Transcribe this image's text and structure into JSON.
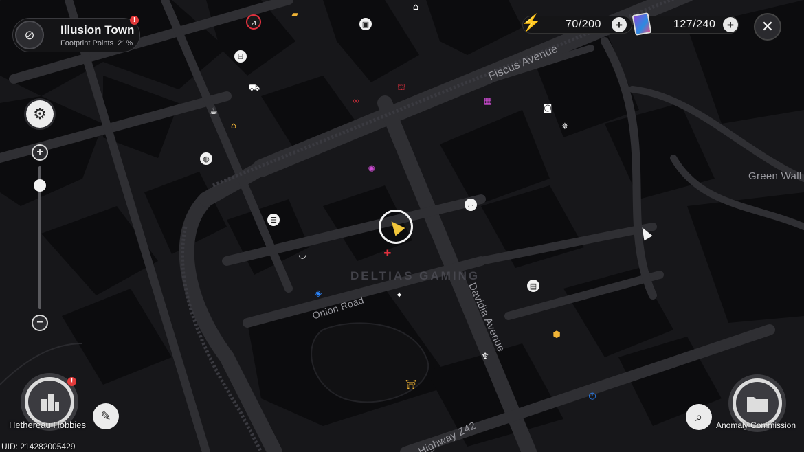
{
  "location": {
    "name": "Illusion Town",
    "footprint_label": "Footprint Points",
    "footprint_value": "21%",
    "alert": "!"
  },
  "resources": [
    {
      "id": "battery",
      "icon": "battery-icon",
      "value": "70/200"
    },
    {
      "id": "cards",
      "icon": "card-icon",
      "value": "127/240"
    }
  ],
  "streets": {
    "fiscus": "Fiscus Avenue",
    "green_wall": "Green Wall",
    "onion": "Onion Road",
    "davidia": "Davidia Avenue",
    "highway": "Highway Z42"
  },
  "bottom": {
    "hobbies_label": "Hethereau Hobbies",
    "hobbies_alert": "!",
    "anomaly_label": "Anomaly Commission",
    "uid": "UID: 214282005429"
  },
  "watermark": "DELTIAS  GAMING",
  "controls": {
    "zoom_in": "+",
    "zoom_out": "−",
    "close": "✕",
    "settings": "⚙",
    "plus": "+"
  },
  "colors": {
    "map_bg": "#17171a",
    "road": "#2f2f33",
    "building": "#0e0e10",
    "accent_gold": "#f1b436",
    "accent_red": "#e2313e"
  },
  "map_icons": [
    {
      "name": "warp-beacon-icon",
      "glyph": "⩘",
      "cls": "redring"
    },
    {
      "name": "gold-stack-icon",
      "glyph": "▰",
      "cls": "gold"
    },
    {
      "name": "building-icon",
      "glyph": "⌂",
      "cls": ""
    },
    {
      "name": "gift-icon",
      "glyph": "▣",
      "cls": "bubble"
    },
    {
      "name": "shop-stall-icon",
      "glyph": "⌸",
      "cls": "bubble"
    },
    {
      "name": "camera-icon",
      "glyph": "◙",
      "cls": ""
    },
    {
      "name": "shopping-cart-icon",
      "glyph": "⛟",
      "cls": ""
    },
    {
      "name": "red-gate-icon",
      "glyph": "⛫",
      "cls": "red"
    },
    {
      "name": "red-link-icon",
      "glyph": "∞",
      "cls": "red"
    },
    {
      "name": "magenta-shop-icon",
      "glyph": "▦",
      "cls": "purple"
    },
    {
      "name": "coffee-icon",
      "glyph": "☕",
      "cls": ""
    },
    {
      "name": "home-icon",
      "glyph": "⌂",
      "cls": "gold"
    },
    {
      "name": "washer-icon",
      "glyph": "◍",
      "cls": "bubble"
    },
    {
      "name": "emblem-icon",
      "glyph": "✺",
      "cls": "purple"
    },
    {
      "name": "burger-icon",
      "glyph": "☰",
      "cls": "bubble"
    },
    {
      "name": "sofa-icon",
      "glyph": "⌓",
      "cls": "bubble"
    },
    {
      "name": "noodle-bowl-icon",
      "glyph": "◡",
      "cls": ""
    },
    {
      "name": "medical-icon",
      "glyph": "✚",
      "cls": "red"
    },
    {
      "name": "police-badge-icon",
      "glyph": "◈",
      "cls": "blue"
    },
    {
      "name": "bangboo-icon",
      "glyph": "✦",
      "cls": ""
    },
    {
      "name": "store-icon",
      "glyph": "▤",
      "cls": "bubble"
    },
    {
      "name": "ice-cream-icon",
      "glyph": "♆",
      "cls": ""
    },
    {
      "name": "crate-icon",
      "glyph": "⬢",
      "cls": "gold"
    },
    {
      "name": "temple-icon",
      "glyph": "⛩",
      "cls": "gold"
    },
    {
      "name": "clock-icon",
      "glyph": "◷",
      "cls": "blue"
    },
    {
      "name": "target-icon",
      "glyph": "✵",
      "cls": ""
    }
  ]
}
